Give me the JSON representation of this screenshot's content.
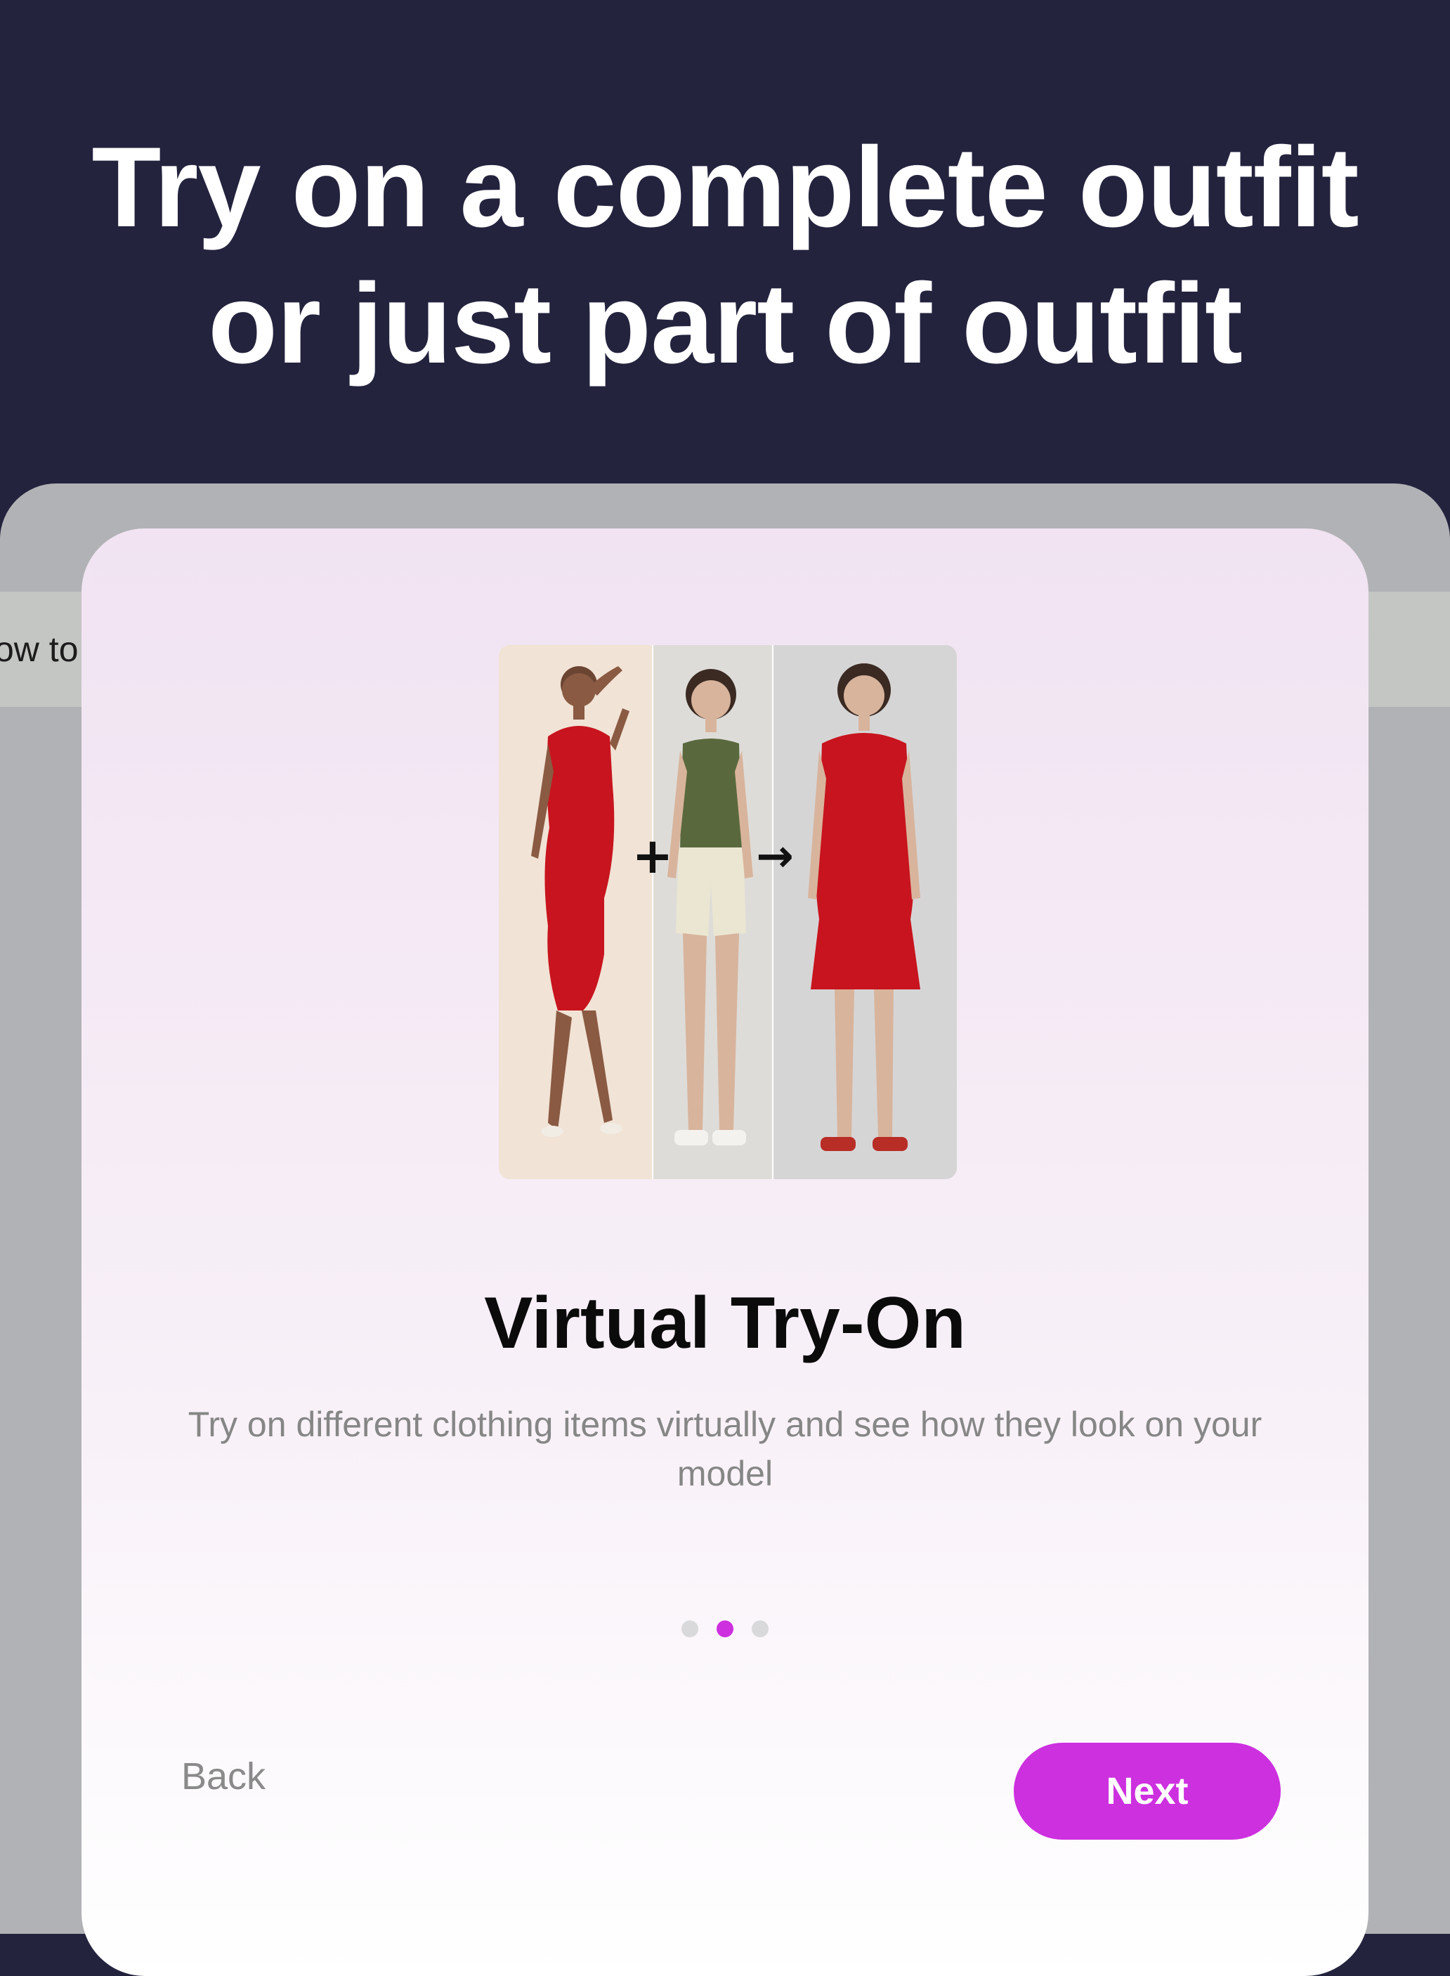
{
  "hero": {
    "line1": "Try on a complete outfit",
    "line2": "or just part of outfit"
  },
  "background": {
    "partial_text": "ow to"
  },
  "onboarding": {
    "title": "Virtual Try-On",
    "description": "Try on different clothing items virtually and see how they look on your model",
    "page_indicator": {
      "total": 3,
      "current": 2
    },
    "back_label": "Back",
    "next_label": "Next"
  },
  "colors": {
    "hero_bg": "#23233e",
    "accent": "#cd30df",
    "dress": "#c8141e",
    "top": "#59693d",
    "shorts": "#ebe6d2"
  },
  "illustration": {
    "plus_symbol": "+",
    "arrow_symbol": "→"
  }
}
